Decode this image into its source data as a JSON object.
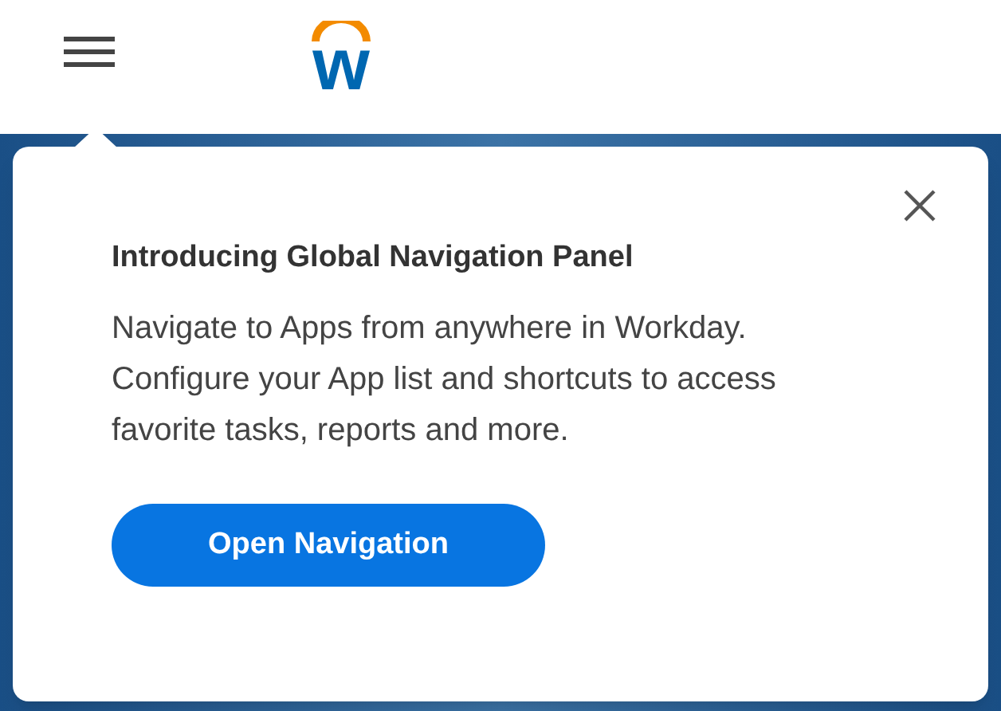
{
  "header": {
    "logo_letter": "w"
  },
  "popover": {
    "title": "Introducing Global Navigation Panel",
    "body": "Navigate to Apps from anywhere in Workday. Configure your App list and shortcuts to access favorite tasks, reports and more.",
    "button": "Open Navigation"
  }
}
